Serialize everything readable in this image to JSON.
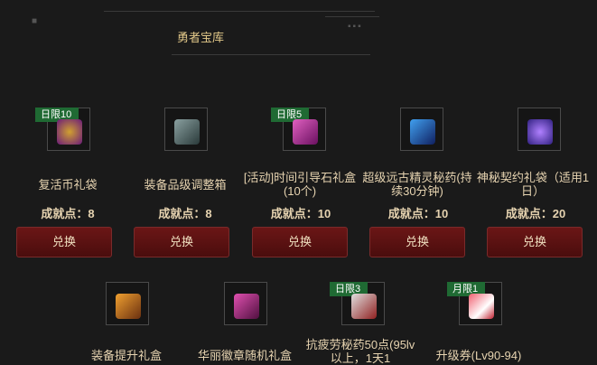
{
  "header": {
    "title": "勇者宝库"
  },
  "points_label": "成就点：",
  "items": [
    {
      "badge": "日限10",
      "name": "复活币礼袋",
      "points": "8",
      "button": "兑换",
      "icon": "coin-bag-icon",
      "color": "#7b2a8a"
    },
    {
      "badge": "",
      "name": "装备品级调整箱",
      "points": "8",
      "button": "兑换",
      "icon": "adjust-box-icon",
      "color": "#5a6a6a"
    },
    {
      "badge": "日限5",
      "name": "[活动]时间引导石礼盒 (10个)",
      "points": "10",
      "button": "兑换",
      "icon": "gift-box-icon",
      "color": "#b03090"
    },
    {
      "badge": "",
      "name": "超级远古精灵秘药(持续30分钟)",
      "points": "10",
      "button": "兑换",
      "icon": "potion-icon",
      "color": "#2050b0"
    },
    {
      "badge": "",
      "name": "神秘契约礼袋（适用1日）",
      "points": "20",
      "button": "兑换",
      "icon": "contract-bag-icon",
      "color": "#6040c0"
    },
    {
      "badge": "",
      "name": "装备提升礼盒",
      "points": "",
      "button": "",
      "icon": "upgrade-box-icon",
      "color": "#c07020"
    },
    {
      "badge": "",
      "name": "华丽徽章随机礼盒",
      "points": "",
      "button": "",
      "icon": "emblem-box-icon",
      "color": "#a02070"
    },
    {
      "badge": "日限3",
      "name": "抗疲劳秘药50点(95lv以上，1天1",
      "points": "",
      "button": "",
      "icon": "fatigue-potion-icon",
      "color": "#903030"
    },
    {
      "badge": "月限1",
      "name": "升级券(Lv90-94)",
      "points": "",
      "button": "",
      "icon": "level-ticket-icon",
      "color": "#c03040"
    }
  ]
}
